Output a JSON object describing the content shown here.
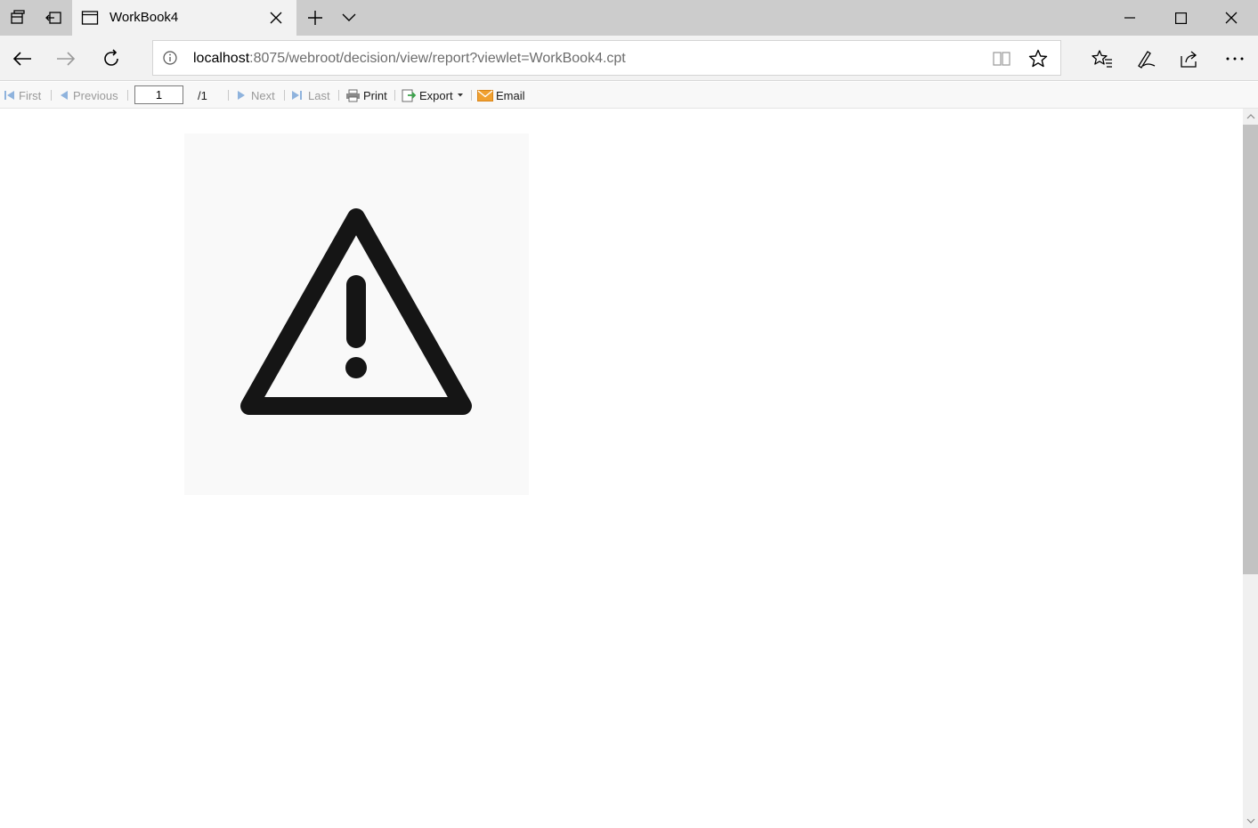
{
  "browser": {
    "tab": {
      "title": "WorkBook4"
    },
    "address": {
      "host": "localhost",
      "rest": ":8075/webroot/decision/view/report?viewlet=WorkBook4.cpt"
    }
  },
  "report_toolbar": {
    "first": "First",
    "previous": "Previous",
    "page_value": "1",
    "page_total": "/1",
    "next": "Next",
    "last": "Last",
    "print": "Print",
    "export": "Export",
    "email": "Email"
  },
  "colors": {
    "titlebar": "#cccccc",
    "navbar": "#f2f2f2",
    "accent_blue": "#4f8fd6",
    "export_green": "#3aa34a",
    "email_orange": "#f0a030"
  },
  "icons": {
    "content": "warning-triangle-icon"
  }
}
